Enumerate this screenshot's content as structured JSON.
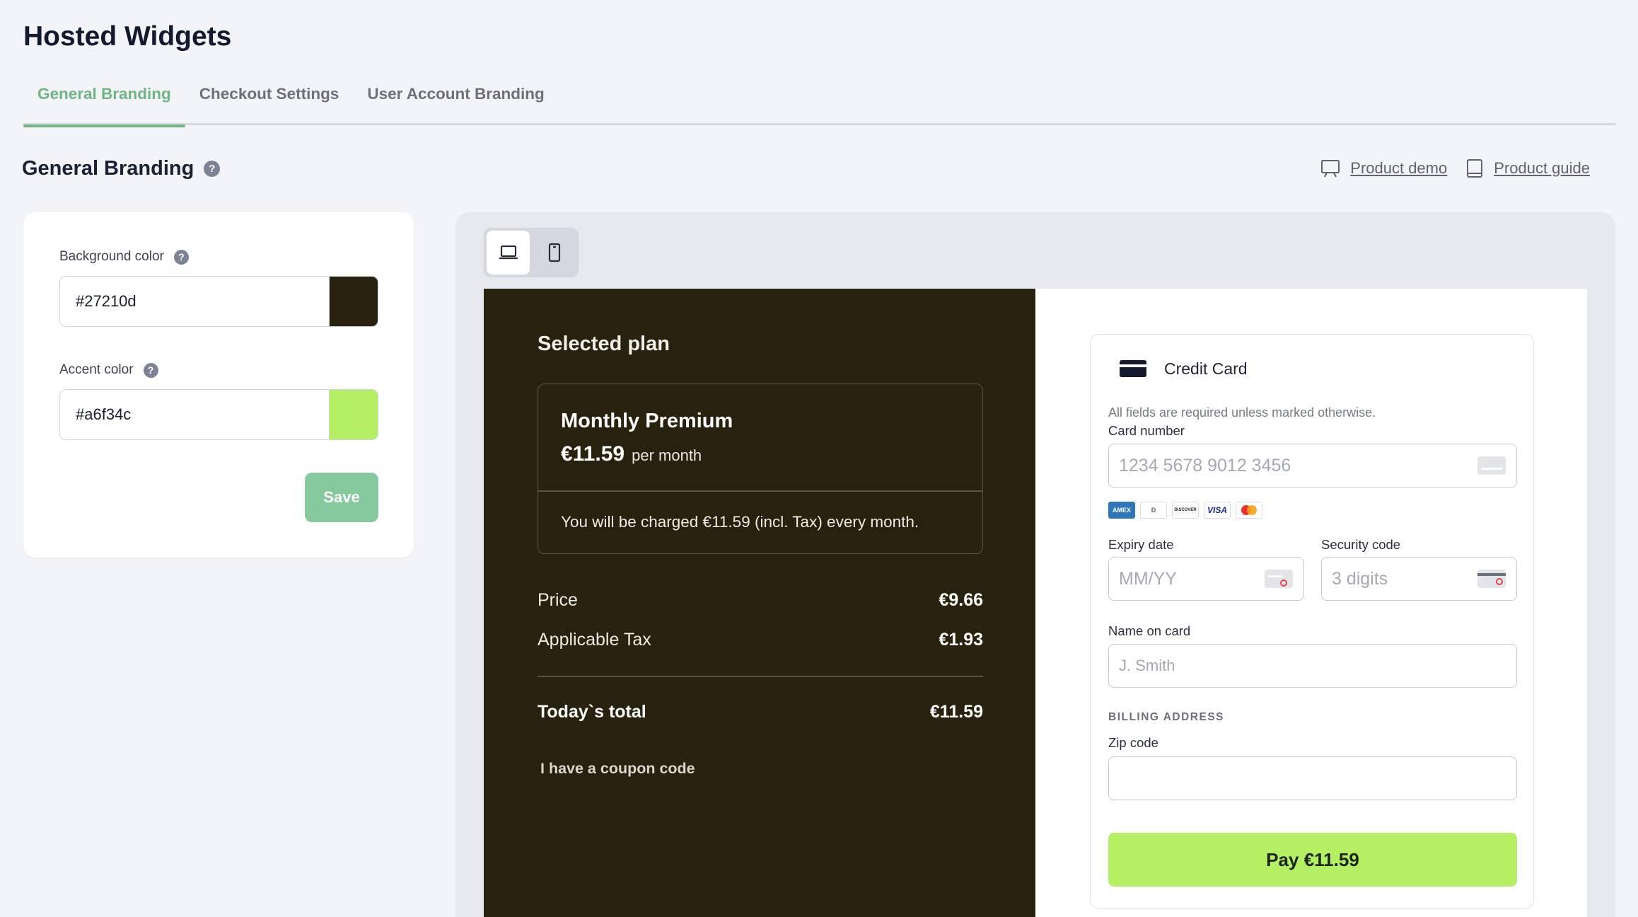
{
  "page": {
    "title": "Hosted Widgets"
  },
  "tabs": [
    {
      "label": "General Branding",
      "active": true
    },
    {
      "label": "Checkout Settings",
      "active": false
    },
    {
      "label": "User Account Branding",
      "active": false
    }
  ],
  "section": {
    "title": "General Branding"
  },
  "links": {
    "demo": "Product demo",
    "guide": "Product guide"
  },
  "settings": {
    "background_label": "Background color",
    "background_value": "#27210d",
    "accent_label": "Accent color",
    "accent_value": "#a6f34c",
    "save_label": "Save"
  },
  "colors": {
    "tab_active": "#6fb585",
    "save_button": "#86c99d",
    "pay_button": "#b5f064"
  },
  "checkout": {
    "plan_heading": "Selected plan",
    "plan_name": "Monthly Premium",
    "plan_price": "€11.59",
    "plan_period": "per month",
    "plan_note": "You will be charged €11.59 (incl. Tax) every month.",
    "price_label": "Price",
    "price_value": "€9.66",
    "tax_label": "Applicable Tax",
    "tax_value": "€1.93",
    "total_label": "Today`s total",
    "total_value": "€11.59",
    "coupon_label": "I have a coupon code"
  },
  "form": {
    "method": "Credit Card",
    "hint": "All fields are required unless marked otherwise.",
    "card_number_label": "Card number",
    "card_number_placeholder": "1234 5678 9012 3456",
    "card_brands": [
      "AMEX",
      "D",
      "DISCOVER",
      "VISA",
      "mastercard"
    ],
    "expiry_label": "Expiry date",
    "expiry_placeholder": "MM/YY",
    "cvc_label": "Security code",
    "cvc_placeholder": "3 digits",
    "name_label": "Name on card",
    "name_placeholder": "J. Smith",
    "billing_heading": "BILLING ADDRESS",
    "zip_label": "Zip code",
    "zip_value": "",
    "pay_label": "Pay €11.59"
  }
}
